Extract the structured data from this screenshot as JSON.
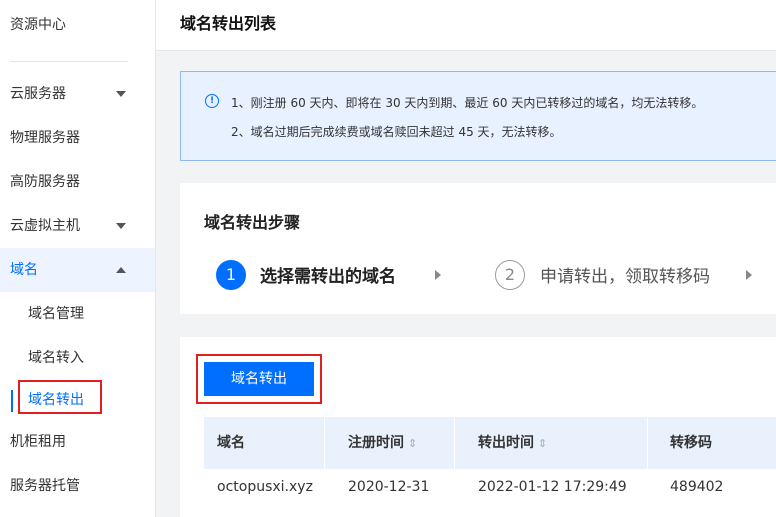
{
  "sidebar": {
    "header": "资源中心",
    "items": [
      {
        "label": "云服务器",
        "expand": "down"
      },
      {
        "label": "物理服务器"
      },
      {
        "label": "高防服务器"
      },
      {
        "label": "云虚拟主机",
        "expand": "down"
      },
      {
        "label": "域名",
        "expand": "up",
        "active": true
      }
    ],
    "sub_items": [
      {
        "label": "域名管理"
      },
      {
        "label": "域名转入"
      },
      {
        "label": "域名转出",
        "selected": true
      }
    ],
    "bottom_items": [
      {
        "label": "机柜租用"
      },
      {
        "label": "服务器托管"
      }
    ]
  },
  "page": {
    "title": "域名转出列表"
  },
  "notice": {
    "icon": "info-icon",
    "lines": [
      "1、刚注册 60 天内、即将在 30 天内到期、最近 60 天内已转移过的域名，均无法转移。",
      "2、域名过期后完成续费或域名赎回未超过 45 天，无法转移。"
    ]
  },
  "steps": {
    "title": "域名转出步骤",
    "items": [
      {
        "number": "1",
        "label": "选择需转出的域名"
      },
      {
        "number": "2",
        "label": "申请转出，领取转移码"
      }
    ]
  },
  "table": {
    "action_button": "域名转出",
    "columns": [
      {
        "label": "域名"
      },
      {
        "label": "注册时间",
        "sort": "⇕"
      },
      {
        "label": "转出时间",
        "sort": "⇕"
      },
      {
        "label": "转移码"
      }
    ],
    "rows": [
      [
        "octopusxi.xyz",
        "2020-12-31",
        "2022-01-12 17:29:49",
        "489402"
      ]
    ]
  },
  "colors": {
    "accent": "#006eff",
    "highlight_border": "#e02020"
  }
}
